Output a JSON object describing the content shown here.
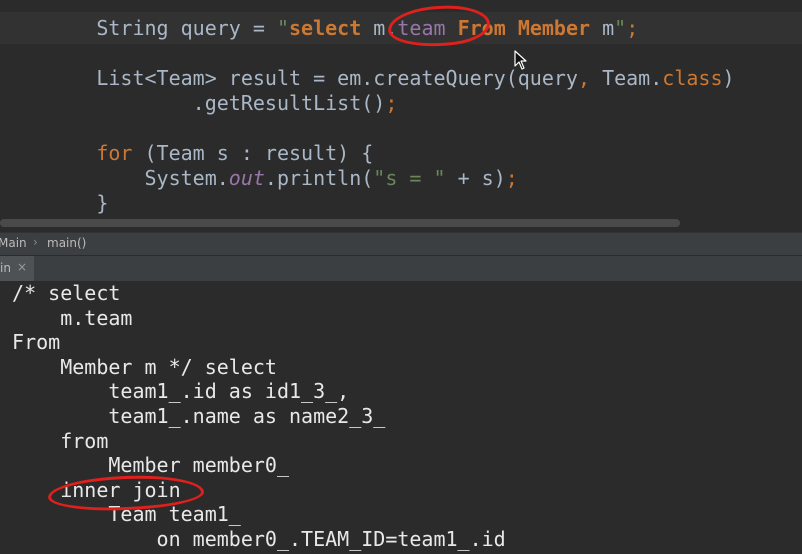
{
  "editor": {
    "lines": [
      {
        "indent": "        ",
        "tokens": [
          {
            "t": "String query = ",
            "c": "id"
          },
          {
            "t": "\"",
            "c": "str"
          },
          {
            "t": "select ",
            "c": "sq"
          },
          {
            "t": "m.",
            "c": "id"
          },
          {
            "t": "team",
            "c": "fld"
          },
          {
            "t": " From ",
            "c": "sq"
          },
          {
            "t": "Member",
            "c": "sq"
          },
          {
            "t": " m",
            "c": "id"
          },
          {
            "t": "\"",
            "c": "str"
          },
          {
            "t": ";",
            "c": "pun"
          }
        ]
      },
      {
        "indent": "",
        "tokens": []
      },
      {
        "indent": "        ",
        "tokens": [
          {
            "t": "List<Team> result = em.createQuery(query",
            "c": "id"
          },
          {
            "t": ", ",
            "c": "pun"
          },
          {
            "t": "Team.",
            "c": "id"
          },
          {
            "t": "class",
            "c": "kw"
          },
          {
            "t": ")",
            "c": "id"
          }
        ]
      },
      {
        "indent": "                ",
        "tokens": [
          {
            "t": ".getResultList()",
            "c": "id"
          },
          {
            "t": ";",
            "c": "pun"
          }
        ]
      },
      {
        "indent": "",
        "tokens": []
      },
      {
        "indent": "        ",
        "tokens": [
          {
            "t": "for",
            "c": "kw"
          },
          {
            "t": " (Team s : result) {",
            "c": "id"
          }
        ]
      },
      {
        "indent": "            ",
        "tokens": [
          {
            "t": "System.",
            "c": "id"
          },
          {
            "t": "out",
            "c": "sfld"
          },
          {
            "t": ".println(",
            "c": "id"
          },
          {
            "t": "\"s = \"",
            "c": "str"
          },
          {
            "t": " + s)",
            "c": "id"
          },
          {
            "t": ";",
            "c": "pun"
          }
        ]
      },
      {
        "indent": "        ",
        "tokens": [
          {
            "t": "}",
            "c": "id"
          }
        ]
      }
    ]
  },
  "breadcrumb": {
    "items": [
      "Main",
      "main()"
    ]
  },
  "run_panel": {
    "tab_label": "in",
    "close_symbol": "×"
  },
  "console": {
    "lines": [
      " /* select",
      "     m.team",
      " From",
      "     Member m */ select",
      "         team1_.id as id1_3_,",
      "         team1_.name as name2_3_",
      "     from",
      "         Member member0_",
      "     inner join",
      "         Team team1_",
      "             on member0_.TEAM_ID=team1_.id"
    ]
  }
}
